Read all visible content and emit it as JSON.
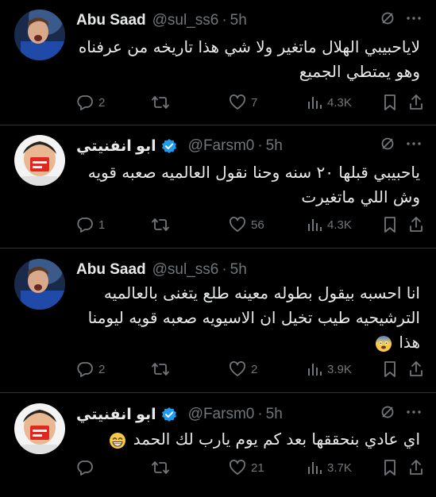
{
  "tweets": [
    {
      "name": "Abu Saad",
      "handle": "@sul_ss6",
      "time": "5h",
      "verified": false,
      "avatar": "player-avatar",
      "text_lines": [
        "لاياحبيبي الهلال ماتغير ولا شي هذا تاريخه من عرفناه",
        "وهو يمتطي الجميع"
      ],
      "replies": "2",
      "retweets": "",
      "likes": "7",
      "views": "4.3K"
    },
    {
      "name": "ابو انفنيتي",
      "handle": "@Farsm0",
      "time": "5h",
      "verified": true,
      "avatar": "child-avatar",
      "text_lines": [
        "ياحبيبي قبلها ٢٠ سنه وحنا نقول العالميه صعبه قويه",
        "وش اللي ماتغيرت"
      ],
      "replies": "1",
      "retweets": "",
      "likes": "56",
      "views": "4.3K"
    },
    {
      "name": "Abu Saad",
      "handle": "@sul_ss6",
      "time": "5h",
      "verified": false,
      "avatar": "player-avatar",
      "text_lines": [
        "انا احسبه بيقول بطوله معينه طلع يتغنى بالعالميه",
        "الترشيحيه طيب تخيل ان الاسيويه صعبه قويه ليومنا",
        "هذا"
      ],
      "replies": "2",
      "retweets": "",
      "likes": "2",
      "views": "3.9K"
    },
    {
      "name": "ابو انفنيتي",
      "handle": "@Farsm0",
      "time": "5h",
      "verified": true,
      "avatar": "child-avatar",
      "text_lines": [
        "اي عادي بنحققها بعد كم يوم يارب لك الحمد"
      ],
      "replies": "",
      "retweets": "",
      "likes": "21",
      "views": "3.7K"
    }
  ],
  "colors": {
    "background": "#000000",
    "text": "#e7e9ea",
    "muted": "#71767b",
    "verified": "#1d9bf0",
    "divider": "#2f3336"
  },
  "icons": [
    "reply-icon",
    "retweet-icon",
    "like-icon",
    "views-icon",
    "bookmark-icon",
    "share-icon",
    "grok-icon",
    "more-icon",
    "verified-badge-icon",
    "fearful-face-emoji",
    "grinning-face-emoji"
  ]
}
